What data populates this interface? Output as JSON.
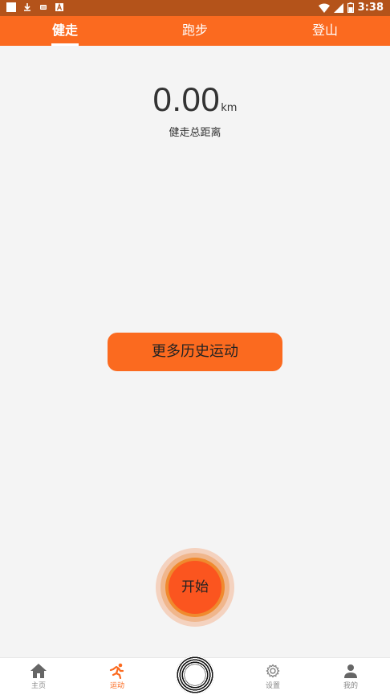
{
  "status_bar": {
    "time": "3:38"
  },
  "tabs": [
    {
      "label": "健走",
      "active": true
    },
    {
      "label": "跑步",
      "active": false
    },
    {
      "label": "登山",
      "active": false
    }
  ],
  "summary": {
    "distance": "0.00",
    "unit": "km",
    "label": "健走总距离"
  },
  "history_button": "更多历史运动",
  "start_button": "开始",
  "bottom_nav": [
    {
      "label": "主页",
      "icon": "home-icon",
      "active": false
    },
    {
      "label": "运动",
      "icon": "running-icon",
      "active": true
    },
    {
      "label": "设置",
      "icon": "gear-icon",
      "active": false
    },
    {
      "label": "我的",
      "icon": "person-icon",
      "active": false
    }
  ],
  "colors": {
    "accent": "#fb6a1f",
    "status_bar": "#b4531a",
    "background": "#f4f4f4"
  }
}
